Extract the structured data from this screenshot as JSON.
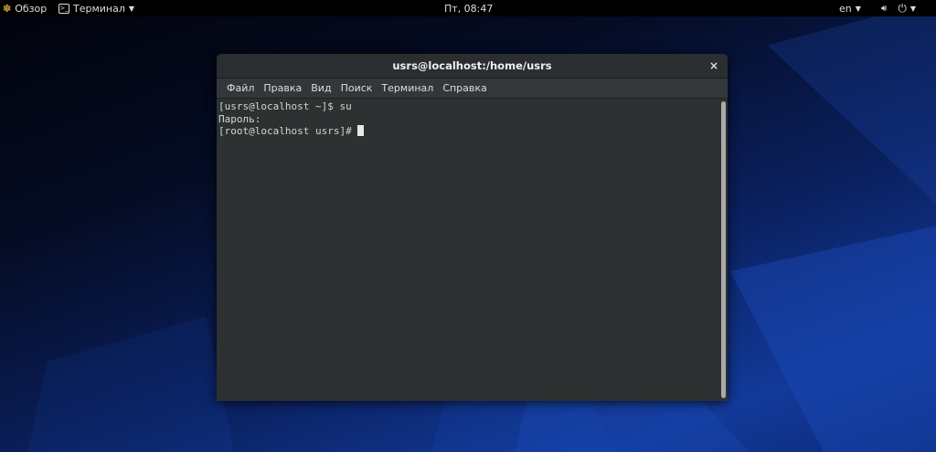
{
  "topbar": {
    "overview": "Обзор",
    "app_menu": "Терминал",
    "clock": "Пт, 08:47",
    "language": "en"
  },
  "window": {
    "title": "usrs@localhost:/home/usrs",
    "close": "×"
  },
  "menu": [
    "Файл",
    "Правка",
    "Вид",
    "Поиск",
    "Терминал",
    "Справка"
  ],
  "terminal": {
    "lines": [
      "[usrs@localhost ~]$ su",
      "Пароль:",
      "[root@localhost usrs]# "
    ]
  },
  "colors": {
    "topbar": "#000000",
    "terminal_bg": "#2d3131",
    "desktop_accent": "#1a4ab8"
  }
}
